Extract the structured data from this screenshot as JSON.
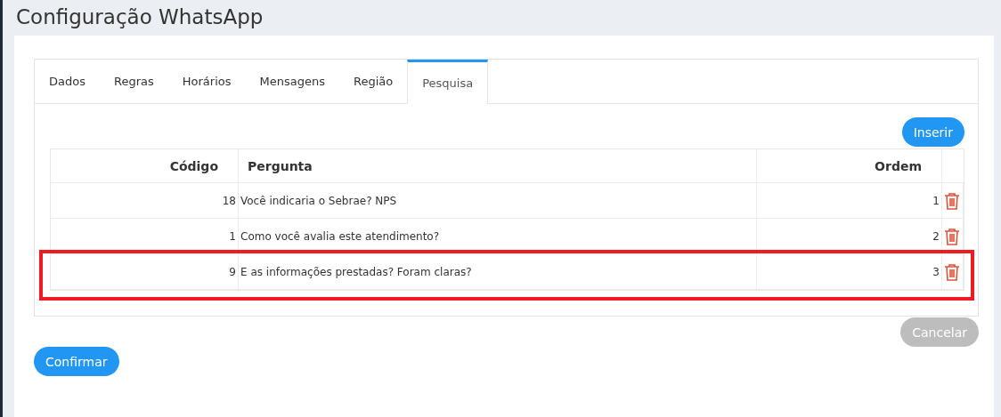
{
  "title": "Configuração WhatsApp",
  "tabs": [
    {
      "label": "Dados",
      "selected": false
    },
    {
      "label": "Regras",
      "selected": false
    },
    {
      "label": "Horários",
      "selected": false
    },
    {
      "label": "Mensagens",
      "selected": false
    },
    {
      "label": "Região",
      "selected": false
    },
    {
      "label": "Pesquisa",
      "selected": true
    }
  ],
  "insert_button": "Inserir",
  "table": {
    "columns": [
      "Código",
      "Pergunta",
      "Ordem"
    ],
    "rows": [
      {
        "code": "18",
        "question": "Você indicaria o Sebrae? NPS",
        "order": "1",
        "highlighted": false
      },
      {
        "code": "1",
        "question": "Como você avalia este atendimento?",
        "order": "2",
        "highlighted": false
      },
      {
        "code": "9",
        "question": "E as informações prestadas? Foram claras?",
        "order": "3",
        "highlighted": true
      }
    ]
  },
  "cancel_button": "Cancelar",
  "confirm_button": "Confirmar"
}
